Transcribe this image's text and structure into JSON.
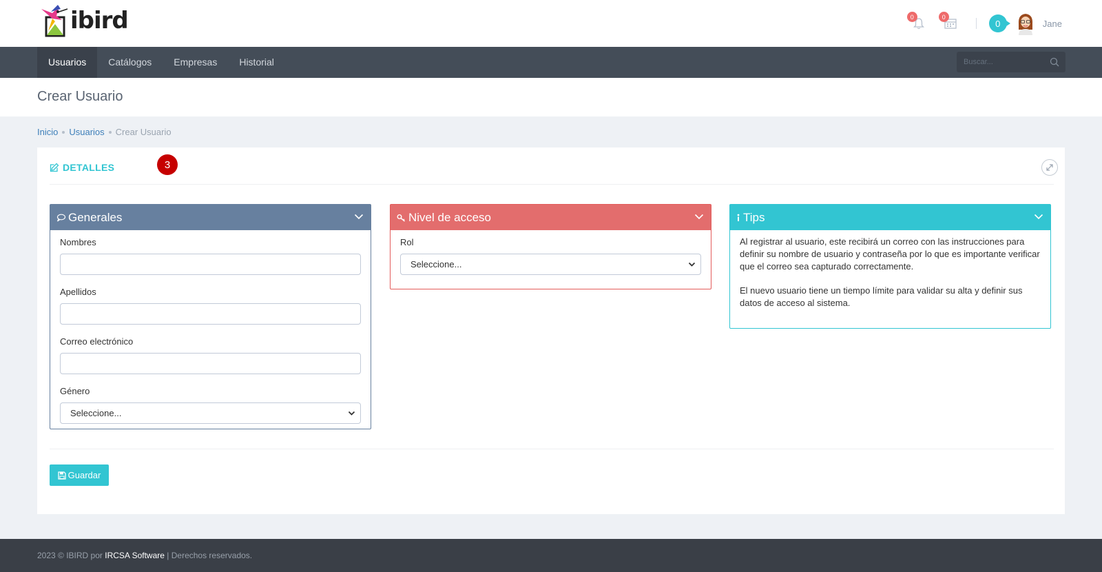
{
  "header": {
    "logo_text": "ibird",
    "notifications_count": "0",
    "calendar_count": "0",
    "inbox_count": "0",
    "user_name": "Jane"
  },
  "nav": {
    "items": [
      "Usuarios",
      "Catálogos",
      "Empresas",
      "Historial"
    ],
    "search_placeholder": "Buscar..."
  },
  "page": {
    "title": "Crear Usuario",
    "breadcrumb": [
      "Inicio",
      "Usuarios",
      "Crear Usuario"
    ]
  },
  "portlet": {
    "caption": "DETALLES",
    "step_badge": "3",
    "generales": {
      "title": "Generales",
      "fields": [
        {
          "label": "Nombres",
          "value": ""
        },
        {
          "label": "Apellidos",
          "value": ""
        },
        {
          "label": "Correo electrónico",
          "value": ""
        }
      ],
      "genero_label": "Género",
      "genero_value": "Seleccione..."
    },
    "acceso": {
      "title": "Nivel de acceso",
      "rol_label": "Rol",
      "rol_value": "Seleccione..."
    },
    "tips": {
      "title": "Tips",
      "paragraphs": [
        "Al registrar al usuario, este recibirá un correo con las instrucciones para definir su nombre de usuario y contraseña por lo que es importante verificar que el correo sea capturado correctamente.",
        "El nuevo usuario tiene un tiempo límite para validar su alta y definir sus datos de acceso al sistema."
      ]
    },
    "save_label": "Guardar"
  },
  "footer": {
    "prefix": "2023 © IBIRD por",
    "brand": "IRCSA Software",
    "suffix": "|  Derechos reservados."
  },
  "colors": {
    "accent": "#32c5d2",
    "nav_bg": "#444d58",
    "box_blue": "#67809f",
    "box_red": "#e36d6d",
    "badge_red": "#c60000"
  },
  "icons": [
    "bell-icon",
    "calendar-icon",
    "search-icon",
    "edit-icon",
    "expand-icon",
    "comment-icon",
    "key-icon",
    "info-icon",
    "chevron-down-icon",
    "save-icon"
  ]
}
